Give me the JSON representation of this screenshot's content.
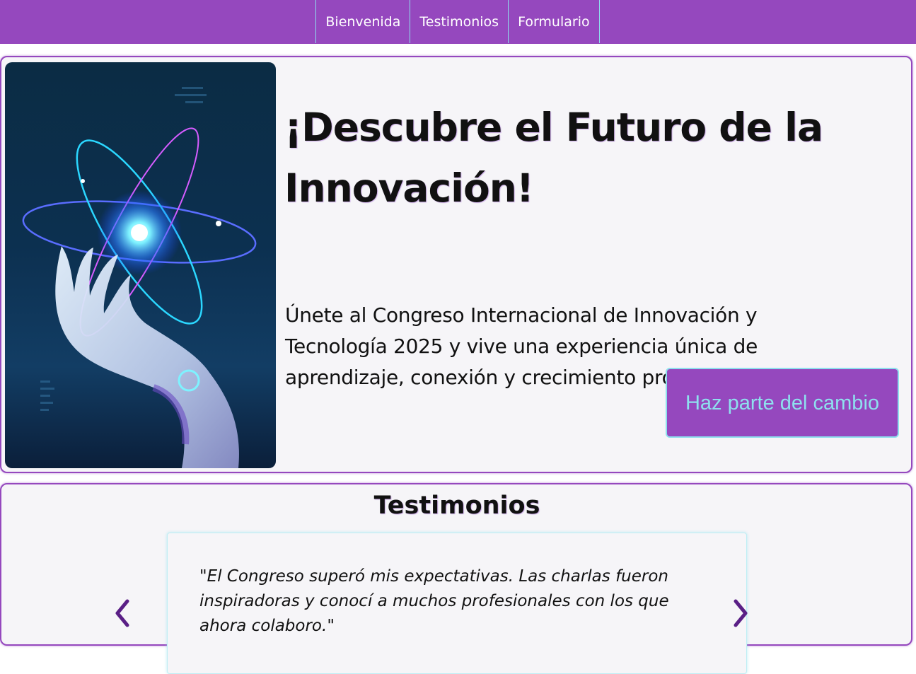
{
  "nav": {
    "items": [
      {
        "label": "Bienvenida"
      },
      {
        "label": "Testimonios"
      },
      {
        "label": "Formulario"
      }
    ]
  },
  "hero": {
    "image_icon": "robot-hand-atom-image",
    "title": "¡Descubre el Futuro de la Innovación!",
    "text": "Únete al Congreso Internacional de Innovación y Tecnología 2025 y vive una experiencia única de aprendizaje, conexión y crecimiento profesional.",
    "cta_label": "Haz parte del cambio"
  },
  "testimonials": {
    "title": "Testimonios",
    "quote": "\"El Congreso superó mis expectativas. Las charlas fueron inspiradoras y conocí a muchos profesionales con los que ahora colaboro.\"",
    "prev_icon": "chevron-left-icon",
    "next_icon": "chevron-right-icon"
  },
  "colors": {
    "primary": "#9548be",
    "accent": "#8ee0ee",
    "surface": "#f6f5f8",
    "text": "#111111"
  }
}
